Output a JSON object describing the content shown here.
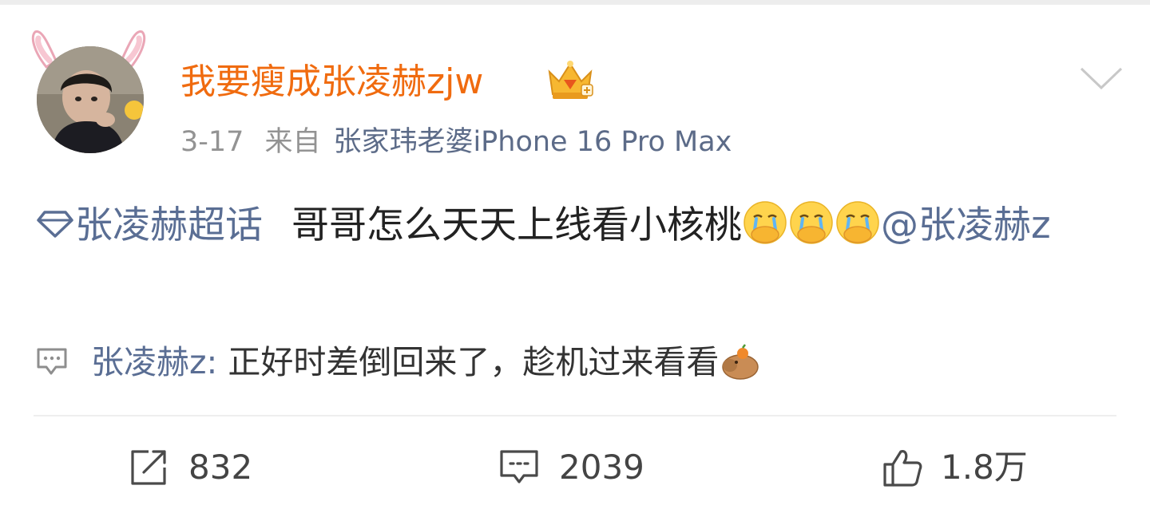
{
  "post": {
    "author": "我要瘦成张凌赫zjw",
    "date": "3-17",
    "source_prefix": "来自",
    "source": "张家玮老婆iPhone 16 Pro Max",
    "topic": "张凌赫超话",
    "text": "哥哥怎么天天上线看小核桃",
    "mention": "@张凌赫z",
    "emoji": "crying-covering-mouth"
  },
  "comment": {
    "author": "张凌赫z:",
    "text": " 正好时差倒回来了，趁机过来看看",
    "emoji": "capybara"
  },
  "actions": {
    "repost_count": "832",
    "comment_count": "2039",
    "like_count": "1.8万"
  },
  "colors": {
    "author": "#f06b0f",
    "link": "#5a6e94",
    "meta": "#939393"
  }
}
